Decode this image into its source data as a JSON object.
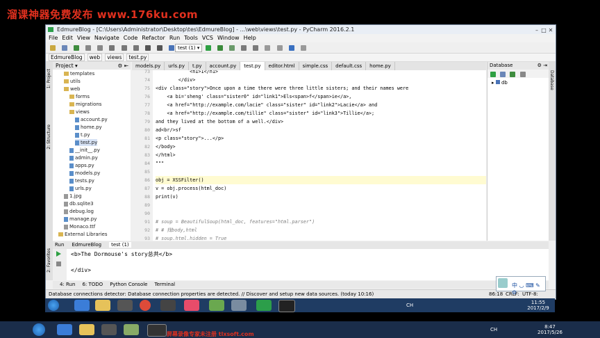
{
  "watermark_top": "溜课神器免费发布 www.176ku.com",
  "watermark_bottom": "屏幕录像专家未注册 tlxsoft.com",
  "window": {
    "title": "EdmureBlog - [C:\\Users\\Administrator\\Desktop\\tes\\EdmureBlog] - ...\\web\\views\\test.py - PyCharm 2016.2.1"
  },
  "menu": [
    "File",
    "Edit",
    "View",
    "Navigate",
    "Code",
    "Refactor",
    "Run",
    "Tools",
    "VCS",
    "Window",
    "Help"
  ],
  "toolbar": {
    "run_config": "test (1)"
  },
  "breadcrumbs": [
    "EdmureBlog",
    "web",
    "views",
    "test.py"
  ],
  "project_panel": {
    "title": "Project"
  },
  "tree": [
    {
      "label": "templates",
      "type": "folder",
      "indent": 2
    },
    {
      "label": "utils",
      "type": "folder",
      "indent": 2
    },
    {
      "label": "web",
      "type": "folder",
      "indent": 2
    },
    {
      "label": "forms",
      "type": "folder",
      "indent": 3
    },
    {
      "label": "migrations",
      "type": "folder",
      "indent": 3
    },
    {
      "label": "views",
      "type": "folder",
      "indent": 3
    },
    {
      "label": "account.py",
      "type": "py",
      "indent": 4
    },
    {
      "label": "home.py",
      "type": "py",
      "indent": 4
    },
    {
      "label": "t.py",
      "type": "py",
      "indent": 4
    },
    {
      "label": "test.py",
      "type": "py",
      "indent": 4
    },
    {
      "label": "__init__.py",
      "type": "py",
      "indent": 3
    },
    {
      "label": "admin.py",
      "type": "py",
      "indent": 3
    },
    {
      "label": "apps.py",
      "type": "py",
      "indent": 3
    },
    {
      "label": "models.py",
      "type": "py",
      "indent": 3
    },
    {
      "label": "tests.py",
      "type": "py",
      "indent": 3
    },
    {
      "label": "urls.py",
      "type": "py",
      "indent": 3
    },
    {
      "label": "1.jpg",
      "type": "other",
      "indent": 2
    },
    {
      "label": "db.sqlite3",
      "type": "other",
      "indent": 2
    },
    {
      "label": "debug.log",
      "type": "other",
      "indent": 2
    },
    {
      "label": "manage.py",
      "type": "py",
      "indent": 2
    },
    {
      "label": "Monaco.ttf",
      "type": "other",
      "indent": 2
    },
    {
      "label": "External Libraries",
      "type": "folder",
      "indent": 1
    }
  ],
  "tabs": [
    "models.py",
    "urls.py",
    "t.py",
    "account.py",
    "test.py",
    "editor.html",
    "simple.css",
    "default.css",
    "home.py"
  ],
  "active_tab": "test.py",
  "code": [
    {
      "n": "73",
      "t": "            <h1>1</h1>"
    },
    {
      "n": "74",
      "t": "        </div>"
    },
    {
      "n": "75",
      "t": "<div class=\"story\">Once upon a time there were three little sisters; and their names were"
    },
    {
      "n": "76",
      "t": "    <a bi='sheng' class=\"sister0\" id=\"link1\">Els<span>f</span>ie</a>,"
    },
    {
      "n": "77",
      "t": "    <a href=\"http://example.com/lacie\" class=\"sister\" id=\"link2\">Lacie</a> and"
    },
    {
      "n": "78",
      "t": "    <a href=\"http://example.com/tillie\" class=\"sister\" id=\"link3\">Tillie</a>;"
    },
    {
      "n": "79",
      "t": "and they lived at the bottom of a well.</div>"
    },
    {
      "n": "80",
      "t": "ad<br/>sf"
    },
    {
      "n": "81",
      "t": "<p class=\"story\">...</p>"
    },
    {
      "n": "82",
      "t": "</body>"
    },
    {
      "n": "83",
      "t": "</html>"
    },
    {
      "n": "84",
      "t": "\"\"\""
    },
    {
      "n": "85",
      "t": ""
    },
    {
      "n": "86",
      "t": "obj = XSSFilter()"
    },
    {
      "n": "87",
      "t": "v = obj.process(html_doc)"
    },
    {
      "n": "88",
      "t": "print(v)"
    },
    {
      "n": "89",
      "t": ""
    },
    {
      "n": "90",
      "t": ""
    },
    {
      "n": "91",
      "t": "# soup = BeautifulSoup(html_doc, features=\"html.parser\")"
    },
    {
      "n": "92",
      "t": "# # 找body,html"
    },
    {
      "n": "93",
      "t": "# soup.html.hidden = True"
    }
  ],
  "database_panel": {
    "title": "Database",
    "item": "db"
  },
  "run_panel": {
    "label": "Run",
    "tabs": [
      "EdmureBlog",
      "test (1)"
    ],
    "output": [
      "<b>The Dormouse's story总共</b>",
      "",
      "</div>"
    ]
  },
  "bottom_tabs": [
    "4: Run",
    "6: TODO",
    "Python Console",
    "Terminal"
  ],
  "status": {
    "message": "Database connections detector: Database connection properties are detected. // Discover and setup new data sources. (today 10:16)",
    "position": "86:18",
    "line_sep": "CRLF:",
    "encoding": "UTF-8:"
  },
  "taskbar_inner": {
    "time": "11:55",
    "date": "2017/2/9",
    "lang": "CH"
  },
  "taskbar_outer": {
    "time": "8:47",
    "date": "2017/5/26",
    "lang": "CH"
  }
}
